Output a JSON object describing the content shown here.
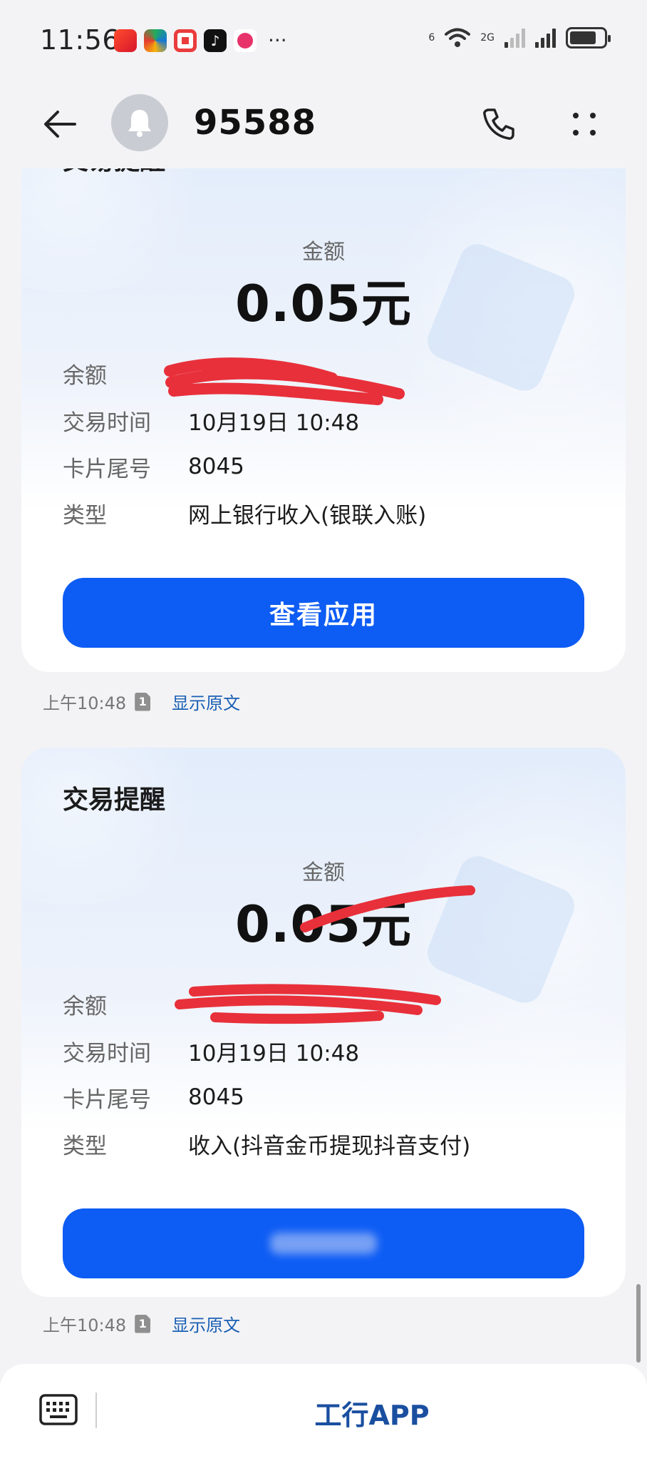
{
  "status_bar": {
    "time": "11:56",
    "signal_label_1": "6",
    "signal_label_2": "2G"
  },
  "header": {
    "contact": "95588"
  },
  "messages": [
    {
      "title": "交易提醒",
      "amount_label": "金额",
      "amount": "0.05元",
      "rows": [
        {
          "key": "余额",
          "value": ""
        },
        {
          "key": "交易时间",
          "value": "10月19日 10:48"
        },
        {
          "key": "卡片尾号",
          "value": "8045"
        },
        {
          "key": "类型",
          "value": "网上银行收入(银联入账)"
        }
      ],
      "button": "查看应用",
      "time": "上午10:48",
      "sim": "1",
      "show_original": "显示原文"
    },
    {
      "title": "交易提醒",
      "amount_label": "金额",
      "amount": "0.05元",
      "rows": [
        {
          "key": "余额",
          "value": ""
        },
        {
          "key": "交易时间",
          "value": "10月19日 10:48"
        },
        {
          "key": "卡片尾号",
          "value": "8045"
        },
        {
          "key": "类型",
          "value": "收入(抖音金币提现抖音支付)"
        }
      ],
      "button": "",
      "time": "上午10:48",
      "sim": "1",
      "show_original": "显示原文"
    }
  ],
  "bottom_bar": {
    "app_link": "工行APP"
  },
  "colors": {
    "accent": "#0d5cf4",
    "link": "#1a5fb4",
    "scribble": "#e8303a"
  }
}
